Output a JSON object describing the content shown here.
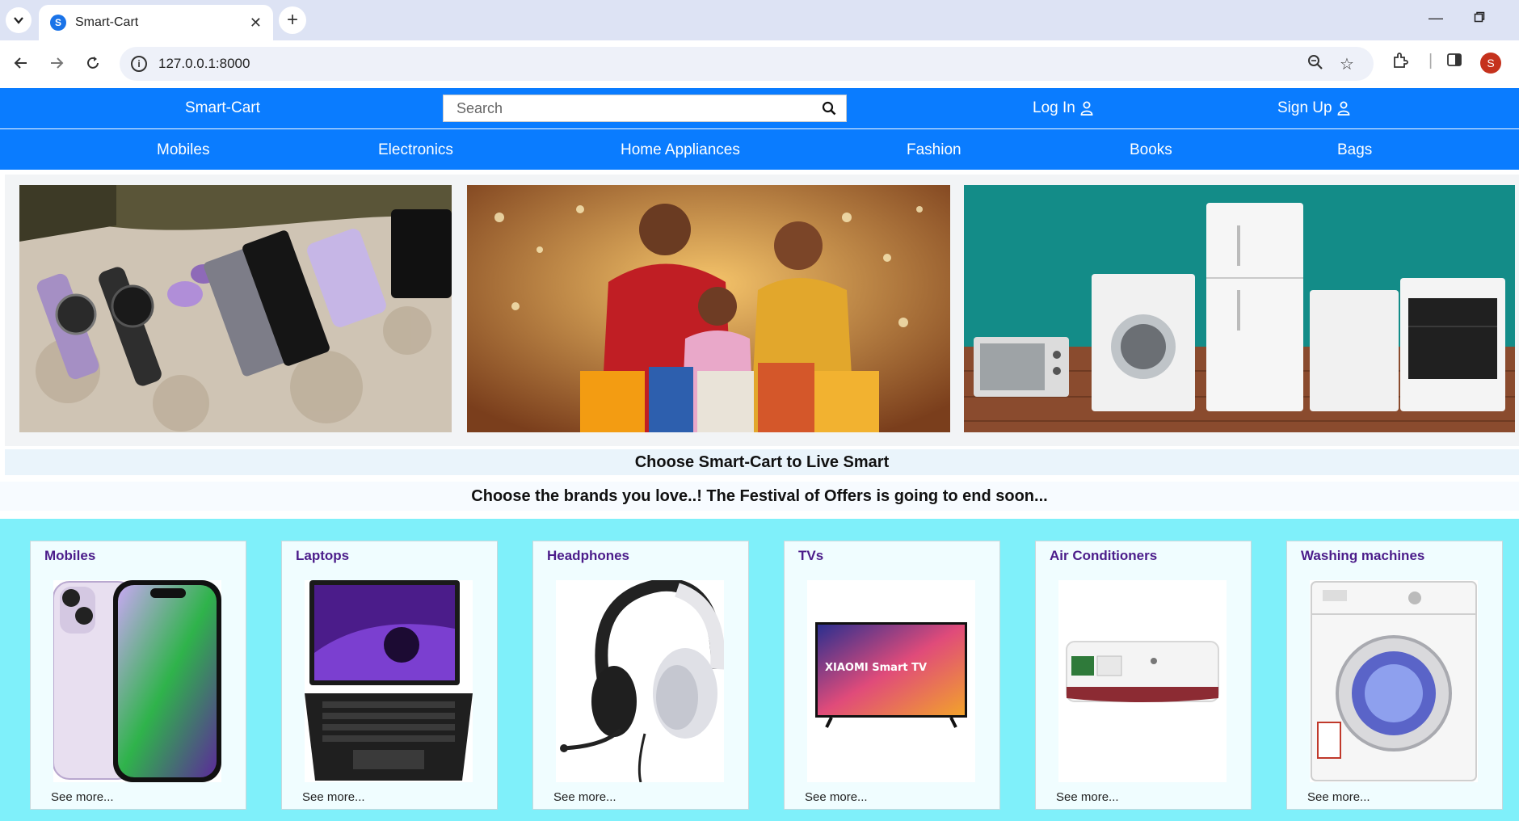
{
  "browser": {
    "tab_title": "Smart-Cart",
    "favicon_letter": "S",
    "url": "127.0.0.1:8000",
    "profile_initial": "S"
  },
  "header": {
    "brand": "Smart-Cart",
    "search_placeholder": "Search",
    "login_label": "Log In",
    "signup_label": "Sign Up"
  },
  "categories": [
    "Mobiles",
    "Electronics",
    "Home Appliances",
    "Fashion",
    "Books",
    "Bags"
  ],
  "taglines": {
    "primary": "Choose Smart-Cart to Live Smart",
    "secondary": "Choose the brands you love..! The Festival of Offers is going to end soon..."
  },
  "products": [
    {
      "title": "Mobiles",
      "more": "See more..."
    },
    {
      "title": "Laptops",
      "more": "See more..."
    },
    {
      "title": "Headphones",
      "more": "See more..."
    },
    {
      "title": "TVs",
      "more": "See more..."
    },
    {
      "title": "Air Conditioners",
      "more": "See more..."
    },
    {
      "title": "Washing machines",
      "more": "See more..."
    }
  ],
  "tv_brand_text": "XIAOMI Smart TV",
  "colors": {
    "nav_blue": "#0a7cff",
    "products_bg": "#7ff0fa",
    "card_title": "#4b1c8a"
  }
}
